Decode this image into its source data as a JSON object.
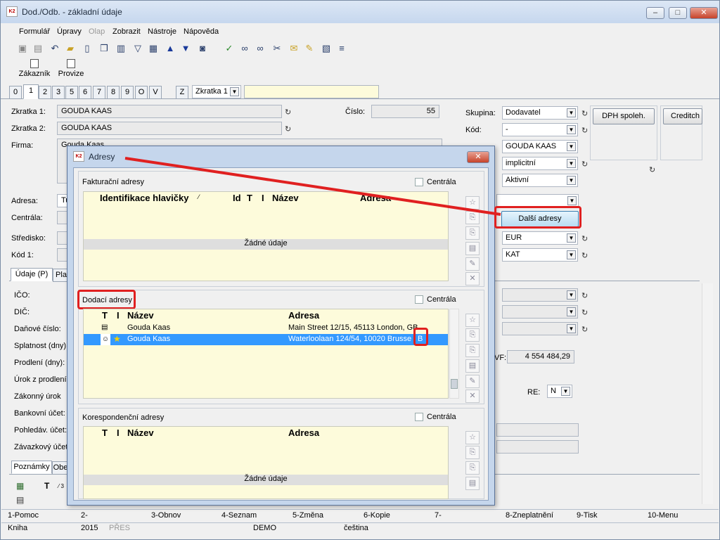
{
  "window": {
    "title": "Dod./Odb. - základní údaje",
    "controls": [
      "–",
      "□",
      "✕"
    ]
  },
  "menu": [
    {
      "label": "Formulář",
      "enabled": true
    },
    {
      "label": "Úpravy",
      "enabled": true
    },
    {
      "label": "Olap",
      "enabled": false
    },
    {
      "label": "Zobrazit",
      "enabled": true
    },
    {
      "label": "Nástroje",
      "enabled": true
    },
    {
      "label": "Nápověda",
      "enabled": true
    }
  ],
  "toolbar_icons": [
    "save-icon",
    "save-all-icon",
    "undo-icon",
    "open-folder-icon",
    "new-document-icon",
    "copy-icon",
    "book-icon",
    "filter-icon",
    "filter-doc-icon",
    "arrow-up-icon",
    "arrow-down-icon",
    "camera-icon",
    "check-filter-icon",
    "binoculars-icon",
    "binoculars-next-icon",
    "tools-icon",
    "mail-icon",
    "notes-icon",
    "tag-icon",
    "menu-lines-icon"
  ],
  "big_buttons": [
    {
      "label": "Zákazník"
    },
    {
      "label": "Provize"
    }
  ],
  "tabs": [
    "0",
    "1",
    "2",
    "3",
    "5",
    "6",
    "7",
    "8",
    "9",
    "O",
    "V"
  ],
  "tab_z": "Z",
  "sort_combo": "Zkratka 1",
  "form": {
    "zkratka1_label": "Zkratka 1:",
    "zkratka1": "GOUDA KAAS",
    "zkratka2_label": "Zkratka 2:",
    "zkratka2": "GOUDA KAAS",
    "firma_label": "Firma:",
    "firma": "Gouda Kaas",
    "cislo_label": "Číslo:",
    "cislo": "55",
    "skupina_label": "Skupina:",
    "skupina": "Dodavatel",
    "kod_label": "Kód:",
    "kod": "-",
    "field3": "GOUDA KAAS",
    "field4": "implicitní",
    "field5": "Aktivní",
    "dph_button": "DPH spoleh.",
    "credit_button": "Creditch",
    "adresa_label": "Adresa:",
    "adresa": "Tu",
    "centrala_label": "Centrála:",
    "dalsi_adresy_button": "Další adresy",
    "stredisko_label": "Středisko:",
    "kod1_label": "Kód 1:",
    "currency": "EUR",
    "kat": "KAT",
    "subtabs": [
      "Údaje (P)",
      "Pla"
    ],
    "left_labels": [
      "IČO:",
      "DIČ:",
      "Daňové číslo:",
      "Splatnost (dny):",
      "Prodlení (dny):",
      "Úrok z prodlení:",
      "Zákonný úrok",
      "Bankovní účet:",
      "Pohledáv. účet:",
      "Závazkový účet"
    ],
    "vf_label": "VF:",
    "vf_value": "4 554 484,29",
    "re_label": "RE:",
    "re_value": "N",
    "bottom_tabs": [
      "Poznámky",
      "Obe"
    ],
    "notes_header_t": "T",
    "notes_header_sort": "⁄ 3"
  },
  "fkeys": [
    "1-Pomoc",
    "2-",
    "3-Obnov",
    "4-Seznam",
    "5-Změna",
    "6-Kopie",
    "7-",
    "8-Zneplatnění",
    "9-Tisk",
    "10-Menu"
  ],
  "status": {
    "module": "Kniha",
    "year": "2015",
    "pres": "PŘES",
    "demo": "DEMO",
    "lang": "čeština"
  },
  "dialog": {
    "title": "Adresy",
    "close": "✕",
    "centrala_label": "Centrála",
    "empty": "Žádné údaje",
    "invoice": {
      "title": "Fakturační adresy",
      "headers": {
        "ident": "Identifikace hlavičky",
        "sort": "⁄",
        "id": "Id",
        "t": "T",
        "i": "I",
        "name": "Název",
        "address": "Adresa"
      }
    },
    "delivery": {
      "title": "Dodací adresy",
      "headers": {
        "t": "T",
        "i": "I",
        "name": "Název",
        "address": "Adresa"
      },
      "rows": [
        {
          "name": "Gouda Kaas",
          "address": "Main Street 12/15, 45113 London, GB",
          "selected": false
        },
        {
          "name": "Gouda Kaas",
          "address": "Waterloolaan 124/54, 10020 Brusse",
          "flag": "B",
          "selected": true
        }
      ]
    },
    "correspondence": {
      "title": "Korespondenční adresy",
      "headers": {
        "t": "T",
        "i": "I",
        "name": "Název",
        "address": "Adresa"
      }
    }
  },
  "accent_colors": {
    "highlight": "#e02020",
    "selection": "#3399ff",
    "grid": "#fdfbdb"
  }
}
